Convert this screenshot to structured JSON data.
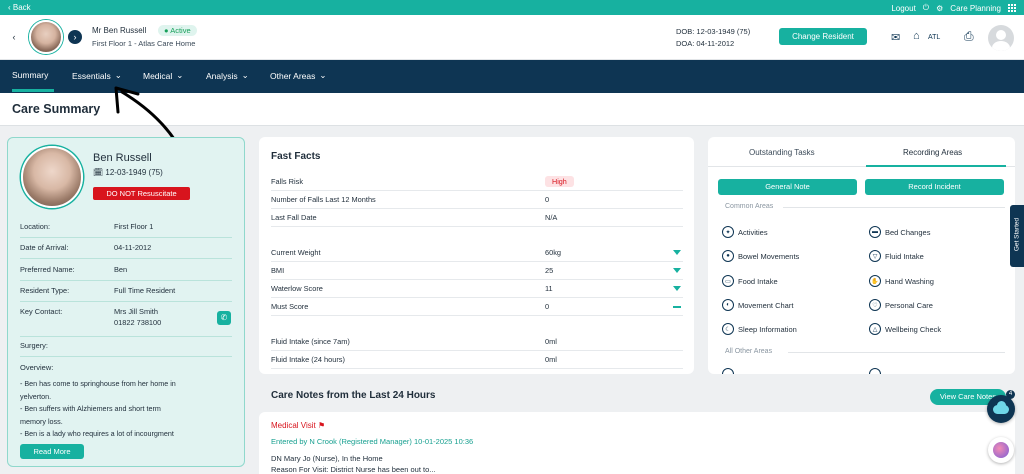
{
  "topbar": {
    "back": "Back",
    "logout": "Logout",
    "app": "Care Planning"
  },
  "resident": {
    "name": "Mr Ben Russell",
    "status": "Active",
    "location": "First Floor 1 - Atlas Care Home",
    "dob": "DOB: 12-03-1949 (75)",
    "doa": "DOA: 04-11-2012",
    "change_btn": "Change Resident",
    "home_code": "ATL"
  },
  "nav": {
    "summary": "Summary",
    "essentials": "Essentials",
    "medical": "Medical",
    "analysis": "Analysis",
    "other": "Other Areas"
  },
  "page_title": "Care Summary",
  "profile": {
    "name": "Ben Russell",
    "dob": "12-03-1949 (75)",
    "dnr": "DO NOT Resuscitate",
    "rows": [
      {
        "k": "Location:",
        "v": "First Floor 1"
      },
      {
        "k": "Date of Arrival:",
        "v": "04-11-2012"
      },
      {
        "k": "Preferred Name:",
        "v": "Ben"
      },
      {
        "k": "Resident Type:",
        "v": "Full Time Resident"
      }
    ],
    "key_contact_label": "Key Contact:",
    "key_contact_name": "Mrs Jill Smith",
    "key_contact_phone": "01822 738100",
    "surgery_label": "Surgery:",
    "overview_label": "Overview:",
    "overview": [
      "- Ben has come to springhouse from her home in",
      "yelverton.",
      "- Ben suffers with Alzhiemers and short term",
      "memory loss.",
      "- Ben is a lady who requires a lot of incourgment"
    ],
    "read_more": "Read More"
  },
  "fast_facts": {
    "title": "Fast Facts",
    "falls_risk_label": "Falls Risk",
    "falls_risk_value": "High",
    "rows_a": [
      {
        "k": "Number of Falls Last 12 Months",
        "v": "0"
      },
      {
        "k": "Last Fall Date",
        "v": "N/A"
      }
    ],
    "rows_b": [
      {
        "k": "Current Weight",
        "v": "60kg"
      },
      {
        "k": "BMI",
        "v": "25"
      },
      {
        "k": "Waterlow Score",
        "v": "11"
      },
      {
        "k": "Must Score",
        "v": "0"
      }
    ],
    "rows_c": [
      {
        "k": "Fluid Intake (since 7am)",
        "v": "0ml"
      },
      {
        "k": "Fluid Intake (24 hours)",
        "v": "0ml"
      }
    ]
  },
  "tasks": {
    "tab1": "Outstanding Tasks",
    "tab2": "Recording Areas",
    "btn1": "General Note",
    "btn2": "Record Incident",
    "common": "Common Areas",
    "all_other": "All Other Areas",
    "areas_left": [
      "Activities",
      "Bowel Movements",
      "Food Intake",
      "Movement Chart",
      "Sleep Information"
    ],
    "areas_right": [
      "Bed Changes",
      "Fluid Intake",
      "Hand Washing",
      "Personal Care",
      "Wellbeing Check"
    ],
    "get_started": "Get Started"
  },
  "care_notes": {
    "title": "Care Notes from the Last 24 Hours",
    "view_btn": "View Care Notes",
    "badge": "4",
    "note_title": "Medical Visit",
    "entered_by": "Entered by N Crook (Registered Manager) 10-01-2025 10:36",
    "line1": "DN Mary Jo (Nurse), In the Home",
    "line2": "Reason For Visit: District Nurse has been out to..."
  }
}
